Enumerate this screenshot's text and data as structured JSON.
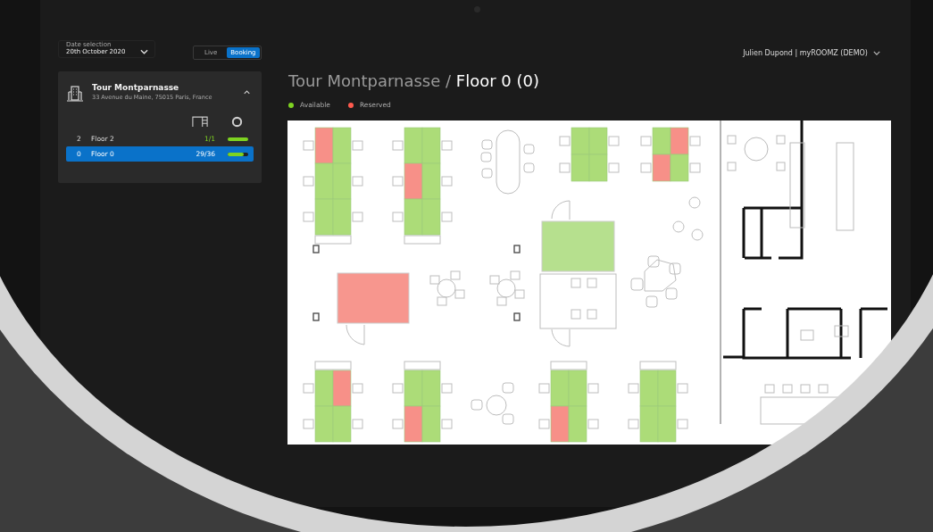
{
  "header": {
    "date_label": "Date selection",
    "date_value": "20th October 2020",
    "modes": [
      {
        "label": "Live",
        "selected": false
      },
      {
        "label": "Booking",
        "selected": true
      }
    ],
    "user": "Julien Dupond | myROOMZ (DEMO)"
  },
  "building": {
    "name": "Tour Montparnasse",
    "address": "33 Avenue du Maine, 75015 Paris, France",
    "expanded": true,
    "floors": [
      {
        "number": "2",
        "name": "Floor 2",
        "count": "1/1",
        "level": 1,
        "selected": false
      },
      {
        "number": "0",
        "name": "Floor 0",
        "count": "29/36",
        "level": 0.8,
        "selected": true
      }
    ]
  },
  "title": {
    "building": "Tour Montparnasse /",
    "floor": "Floor 0 (0)"
  },
  "legend": [
    {
      "label": "Available",
      "color": "#7ed321"
    },
    {
      "label": "Reserved",
      "color": "#ff5a4e"
    }
  ],
  "plan": {
    "desks": [
      {
        "seats": [
          {
            "reserved": true
          },
          {
            "reserved": false
          },
          {
            "reserved": false
          },
          {
            "reserved": false
          },
          {
            "reserved": false
          },
          {
            "reserved": false
          }
        ]
      },
      {
        "seats": [
          {
            "reserved": false
          },
          {
            "reserved": false
          },
          {
            "reserved": true
          },
          {
            "reserved": false
          },
          {
            "reserved": false
          },
          {
            "reserved": false
          }
        ]
      },
      {
        "seats": [
          {
            "reserved": false
          },
          {
            "reserved": false
          },
          {
            "reserved": false
          },
          {
            "reserved": false
          }
        ]
      },
      {
        "seats": [
          {
            "reserved": false
          },
          {
            "reserved": true
          },
          {
            "reserved": true
          },
          {
            "reserved": false
          }
        ]
      },
      {
        "seats": [
          {
            "reserved": false
          },
          {
            "reserved": true
          },
          {
            "reserved": false
          },
          {
            "reserved": false
          }
        ]
      },
      {
        "seats": [
          {
            "reserved": false
          },
          {
            "reserved": false
          },
          {
            "reserved": true
          },
          {
            "reserved": false
          }
        ]
      },
      {
        "seats": [
          {
            "reserved": false
          },
          {
            "reserved": false
          },
          {
            "reserved": true
          },
          {
            "reserved": false
          }
        ]
      },
      {
        "seats": [
          {
            "reserved": false
          },
          {
            "reserved": false
          },
          {
            "reserved": false
          },
          {
            "reserved": false
          }
        ]
      }
    ],
    "rooms": [
      {
        "reserved": true
      },
      {
        "reserved": false
      }
    ]
  }
}
